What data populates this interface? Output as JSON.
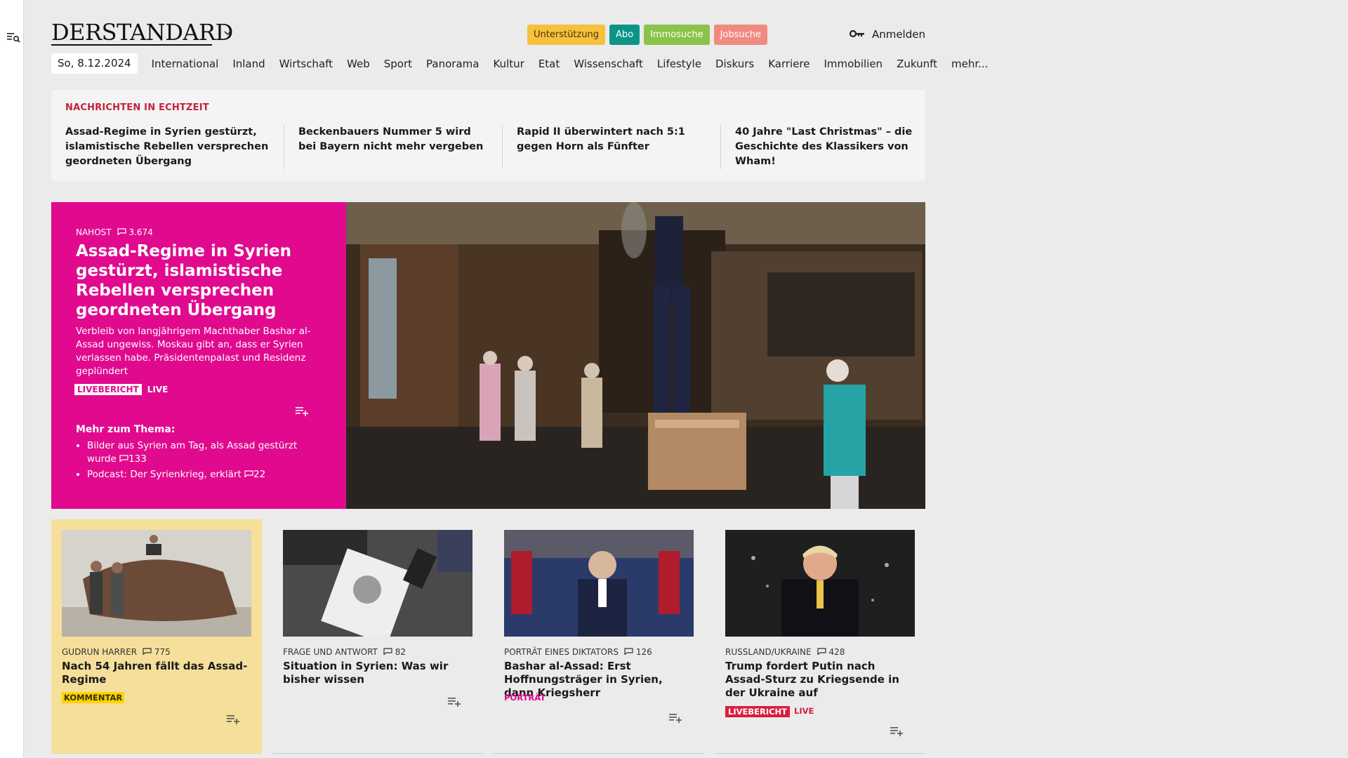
{
  "header": {
    "logo": "DERSTANDARD",
    "pills": [
      "Unterstützung",
      "Abo",
      "Immosuche",
      "Jobsuche"
    ],
    "login_label": "Anmelden"
  },
  "nav": {
    "date": "So, 8.12.2024",
    "items": [
      "International",
      "Inland",
      "Wirtschaft",
      "Web",
      "Sport",
      "Panorama",
      "Kultur",
      "Etat",
      "Wissenschaft",
      "Lifestyle",
      "Diskurs",
      "Karriere",
      "Immobilien",
      "Zukunft",
      "mehr..."
    ]
  },
  "live_strip": {
    "label": "NACHRICHTEN IN ECHTZEIT",
    "items": [
      "Assad-Regime in Syrien gestürzt, isla­mistische Rebellen versprechen ge­ordneten Übergang",
      "Beckenbauers Nummer 5 wird bei Bayern nicht mehr vergeben",
      "Rapid II überwintert nach 5:1 gegen Horn als Fünfter",
      "40 Jahre \"Last Christmas\" – die Ge­schichte des Klassikers von Wham!"
    ]
  },
  "hero": {
    "kicker": "NAHOST",
    "comments": "3.674",
    "title": "Assad-Regime in Syrien gestürzt, islamistische Rebellen versprechen geordneten Übergang",
    "lead": "Verbleib von langjährigem Machthaber Bashar al-Assad ungewiss. Moskau gibt an, dass er Syrien verlassen habe. Präsidentenpalast und Residenz geplündert",
    "badge": "LIVEBERICHT",
    "live": "LIVE",
    "more_title": "Mehr zum Thema:",
    "more": [
      {
        "text": "Bilder aus Syrien am Tag, als Assad gestürzt wurde",
        "comments": "133"
      },
      {
        "text": "Podcast: Der Syrienkrieg, erklärt",
        "comments": "22"
      }
    ]
  },
  "cards": [
    {
      "kicker": "GUDRUN HARRER",
      "comments": "775",
      "title": "Nach 54 Jahren fällt das Assad-Regime",
      "tag": "KOMMENTAR"
    },
    {
      "kicker": "FRAGE UND ANTWORT",
      "comments": "82",
      "title": "Situation in Syrien: Was wir bisher wissen"
    },
    {
      "kicker": "PORTRÄT EINES DIKTATORS",
      "comments": "126",
      "title": "Bashar al-Assad: Erst Hoffnungs­träger in Syrien, dann Kriegsherr",
      "tag": "PORTRÄT"
    },
    {
      "kicker": "RUSSLAND/UKRAINE",
      "comments": "428",
      "title": "Trump fordert Putin nach Assad-Sturz zu Kriegsende in der Ukraine auf",
      "badge": "LIVEBERICHT",
      "live": "LIVE"
    }
  ]
}
